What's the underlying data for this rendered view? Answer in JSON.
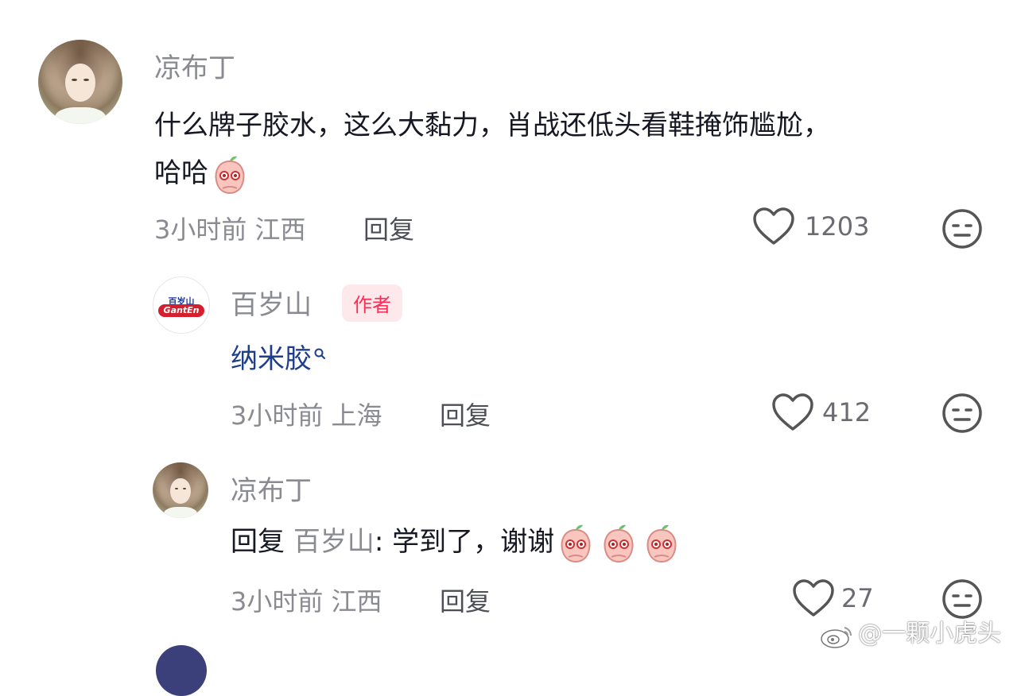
{
  "comments": [
    {
      "username": "凉布丁",
      "text": "什么牌子胶水，这么大黏力，肖战还低头看鞋掩饰尴尬，",
      "text_line2": "哈哈",
      "time_location": "3小时前 江西",
      "reply_label": "回复",
      "likes": "1203"
    },
    {
      "username": "百岁山",
      "author_tag": "作者",
      "avatar_top": "百岁山",
      "avatar_logo": "GantEn",
      "text": "纳米胶",
      "time_location": "3小时前 上海",
      "reply_label": "回复",
      "likes": "412"
    },
    {
      "username": "凉布丁",
      "reply_prefix": "回复",
      "reply_to": "百岁山",
      "text": ": 学到了，谢谢",
      "time_location": "3小时前 江西",
      "reply_label": "回复",
      "likes": "27"
    }
  ],
  "watermark": "@一颗小虎头",
  "icons": {
    "like": "heart-outline-icon",
    "dislike": "neutral-face-icon",
    "search": "search-icon",
    "emoji": "peach-face-emoji",
    "watermark": "weibo-logo-icon"
  },
  "colors": {
    "author_tag": "#fe2c55",
    "link": "#1d3e8a",
    "meta": "#8a8b91"
  }
}
